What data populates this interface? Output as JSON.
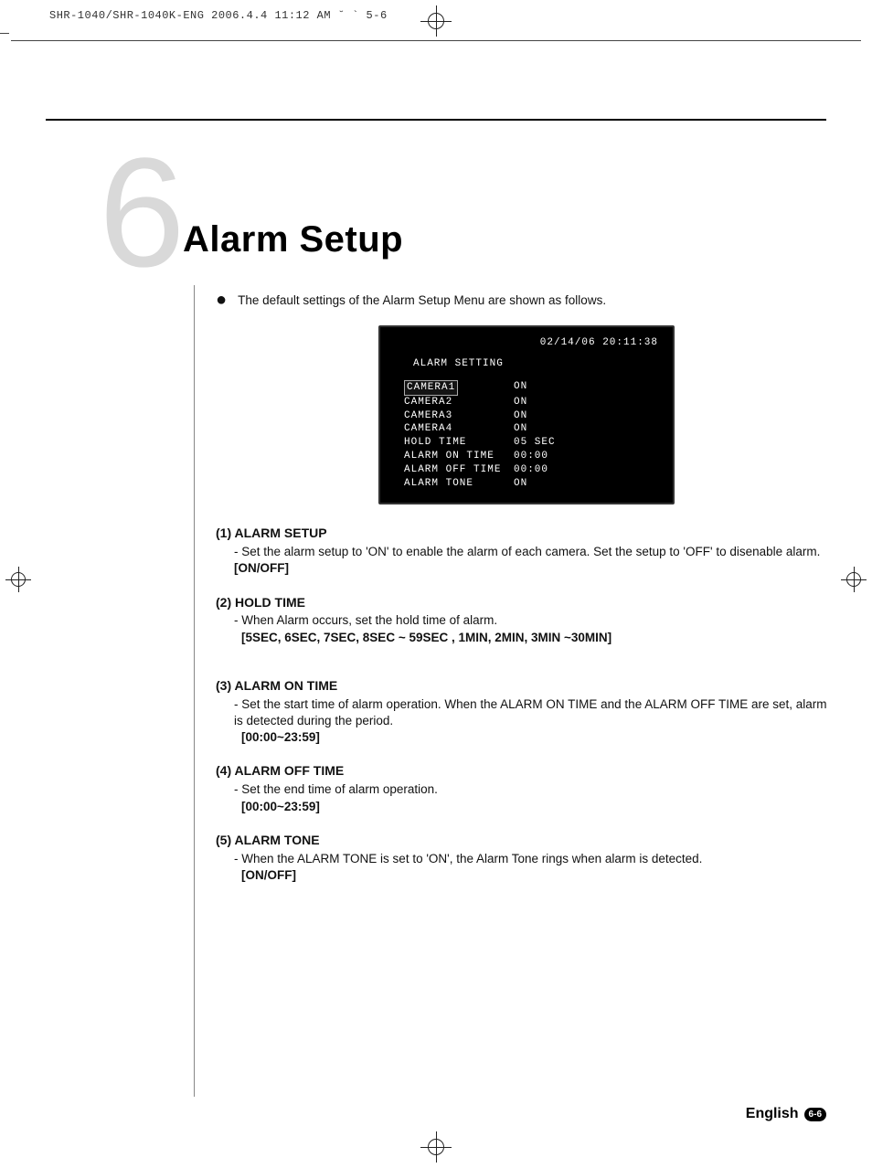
{
  "header_line": "SHR-1040/SHR-1040K-ENG  2006.4.4 11:12 AM  ˘ ` 5-6",
  "chapter": {
    "number": "6",
    "title": "Alarm Setup"
  },
  "intro": "The default settings of the Alarm Setup Menu are shown as follows.",
  "screen": {
    "datetime": "02/14/06  20:11:38",
    "title": "ALARM SETTING",
    "rows": [
      {
        "label": "CAMERA1",
        "value": "ON",
        "selected": true
      },
      {
        "label": "CAMERA2",
        "value": "ON"
      },
      {
        "label": "CAMERA3",
        "value": "ON"
      },
      {
        "label": "CAMERA4",
        "value": "ON"
      },
      {
        "label": "HOLD TIME",
        "value": "05 SEC"
      },
      {
        "label": "ALARM ON TIME",
        "value": "00:00"
      },
      {
        "label": "ALARM OFF TIME",
        "value": "00:00"
      },
      {
        "label": "ALARM TONE",
        "value": "ON"
      }
    ]
  },
  "sections": [
    {
      "title": "(1) ALARM SETUP",
      "body": "- Set the alarm setup to 'ON' to enable the alarm of each camera. Set the setup to 'OFF' to disenable alarm.",
      "options": "[ON/OFF]"
    },
    {
      "title": "(2) HOLD TIME",
      "body": "- When Alarm occurs, set the hold time of alarm.",
      "options": "[5SEC, 6SEC, 7SEC, 8SEC ~ 59SEC , 1MIN, 2MIN, 3MIN ~30MIN]"
    },
    {
      "title": "(3) ALARM ON TIME",
      "body": "- Set the start time of alarm operation. When the ALARM ON TIME and the ALARM OFF TIME are set, alarm is detected during the period.",
      "options": "[00:00~23:59]"
    },
    {
      "title": "(4) ALARM OFF TIME",
      "body": "- Set the end time of alarm operation.",
      "options": "[00:00~23:59]"
    },
    {
      "title": "(5) ALARM TONE",
      "body": "- When the ALARM TONE is set to 'ON', the Alarm Tone rings when alarm is detected.",
      "options": "[ON/OFF]"
    }
  ],
  "footer": {
    "language": "English",
    "page": "6-6"
  }
}
